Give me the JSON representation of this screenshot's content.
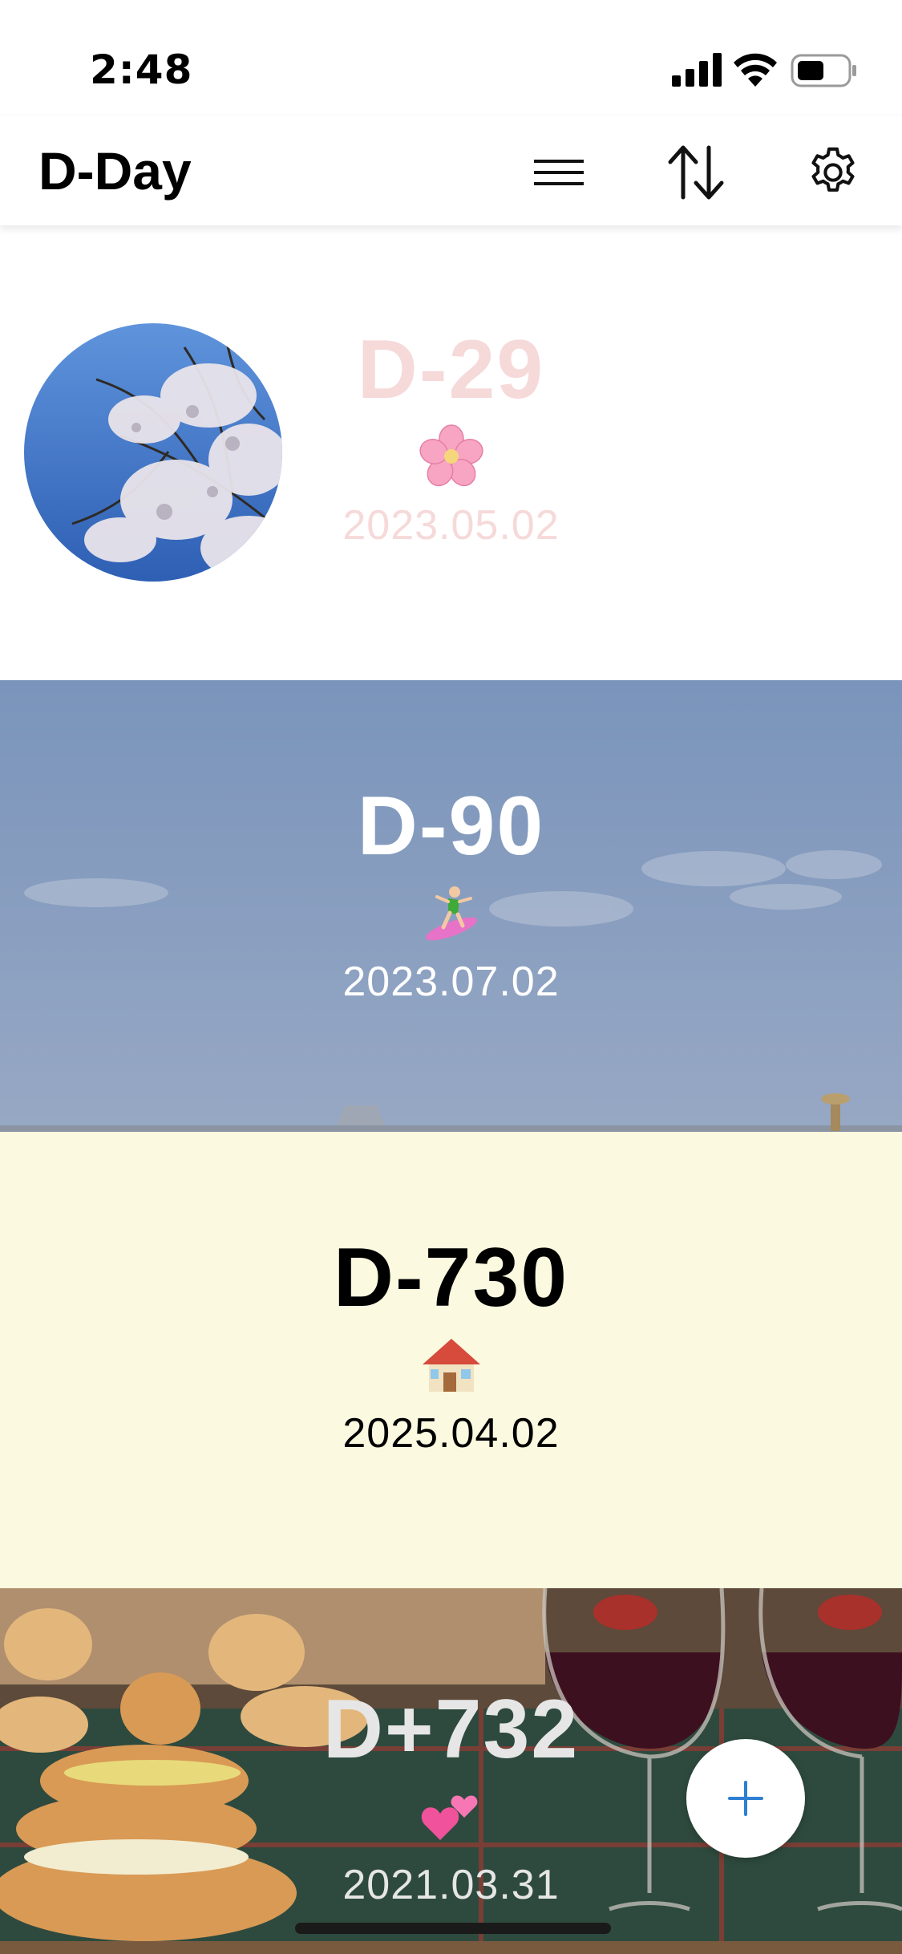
{
  "status_bar": {
    "time": "2:48"
  },
  "header": {
    "title": "D-Day",
    "icons": [
      "menu-icon",
      "sort-icon",
      "settings-icon"
    ]
  },
  "cards": [
    {
      "dday": "D-29",
      "emoji": "cherry-blossom",
      "date": "2023.05.02",
      "text_color": "#f6d9d9",
      "background": "white with circular cherry blossom photo"
    },
    {
      "dday": "D-90",
      "emoji": "person-surfing",
      "date": "2023.07.02",
      "text_color": "#ffffff",
      "background": "sky photo"
    },
    {
      "dday": "D-730",
      "emoji": "house",
      "date": "2025.04.02",
      "text_color": "#000000",
      "background": "#fbf9df"
    },
    {
      "dday": "D+732",
      "emoji": "two-hearts",
      "date": "2021.03.31",
      "text_color": "#e6e6e6",
      "background": "cake and wine photo"
    }
  ],
  "fab": {
    "icon": "plus-icon",
    "color": "#2d7fd3"
  }
}
